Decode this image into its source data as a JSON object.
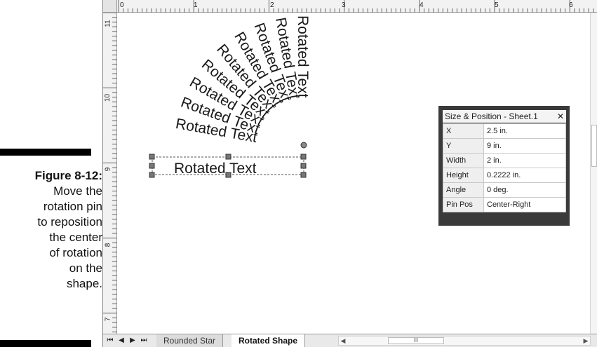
{
  "caption": {
    "figure_label": "Figure 8-12:",
    "lines": [
      "Move the",
      "rotation pin",
      "to reposition",
      "the center",
      "of rotation",
      "on the",
      "shape."
    ]
  },
  "ruler": {
    "horizontal_labels": [
      "0",
      "1",
      "2",
      "3",
      "4",
      "5",
      "6"
    ],
    "vertical_labels": [
      "11",
      "10",
      "9",
      "8",
      "7"
    ]
  },
  "drawing": {
    "text": "Rotated Text",
    "partial_label": "Rotated"
  },
  "size_position": {
    "title": "Size & Position - Sheet.1",
    "close_symbol": "✕",
    "rows": [
      {
        "label": "X",
        "value": "2.5 in."
      },
      {
        "label": "Y",
        "value": "9 in."
      },
      {
        "label": "Width",
        "value": "2 in."
      },
      {
        "label": "Height",
        "value": "0.2222 in."
      },
      {
        "label": "Angle",
        "value": "0 deg."
      },
      {
        "label": "Pin Pos",
        "value": "Center-Right"
      }
    ]
  },
  "tabs": {
    "nav": [
      "⏮",
      "◀",
      "▶",
      "⏭"
    ],
    "items": [
      {
        "label": "Rounded Star",
        "active": false
      },
      {
        "label": "Rotated Shape",
        "active": true
      }
    ],
    "scroll_thumb": "III"
  },
  "colors": {
    "caption_bar": "#000000",
    "panel_border": "#3a3a3a"
  }
}
